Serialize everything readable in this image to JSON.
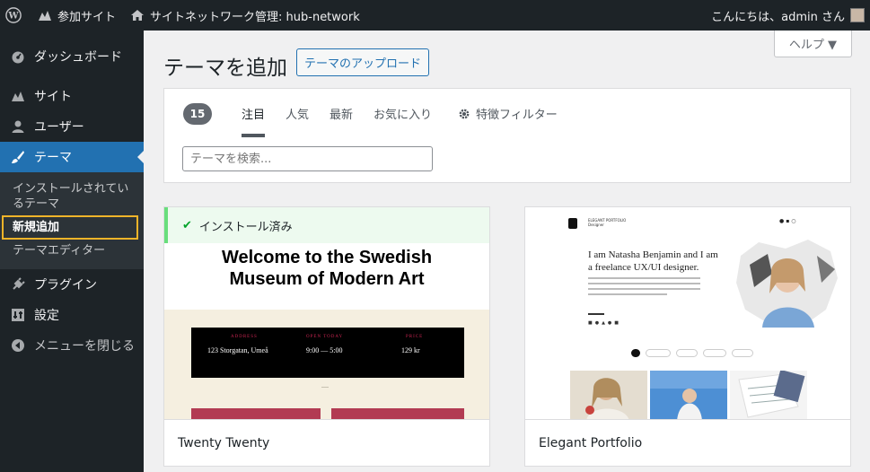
{
  "adminbar": {
    "site_name": "参加サイト",
    "network": "サイトネットワーク管理: hub-network",
    "greeting": "こんにちは、admin さん"
  },
  "sidebar": {
    "items": [
      {
        "label": "ダッシュボード",
        "icon": "gauge-icon"
      },
      {
        "label": "サイト",
        "icon": "sites-icon"
      },
      {
        "label": "ユーザー",
        "icon": "user-icon"
      },
      {
        "label": "テーマ",
        "icon": "brush-icon",
        "current": true
      },
      {
        "label": "プラグイン",
        "icon": "plugin-icon"
      },
      {
        "label": "設定",
        "icon": "settings-icon"
      },
      {
        "label": "メニューを閉じる",
        "icon": "collapse-icon"
      }
    ],
    "submenu": [
      {
        "label": "インストールされているテーマ"
      },
      {
        "label": "新規追加",
        "active": true
      },
      {
        "label": "テーマエディター"
      }
    ]
  },
  "help": {
    "label": "ヘルプ ▼"
  },
  "header": {
    "title": "テーマを追加",
    "upload_label": "テーマのアップロード"
  },
  "filter": {
    "count": "15",
    "tabs": [
      "注目",
      "人気",
      "最新",
      "お気に入り"
    ],
    "feature_filter": "特徴フィルター",
    "search_placeholder": "テーマを検索..."
  },
  "themes": [
    {
      "name": "Twenty Twenty",
      "installed_label": "インストール済み",
      "preview": {
        "heading_line1": "Welcome to the Swedish",
        "heading_line2": "Museum of Modern Art",
        "col1_label": "ADDRESS",
        "col1_value": "123 Storgatan, Umeå",
        "col2_label": "OPEN TODAY",
        "col2_value": "9:00 — 5:00",
        "col3_label": "PRICE",
        "col3_value": "129 kr"
      }
    },
    {
      "name": "Elegant Portfolio",
      "preview": {
        "title": "I am Natasha Benjamin and I am a freelance UX/UI designer.",
        "nav_line1": "ELEGANT PORTFOLIO",
        "nav_line2": "Designer"
      }
    }
  ],
  "colors": {
    "admin_dark": "#1d2327",
    "accent": "#2271b1",
    "installed_green": "#68de7c",
    "highlight": "#f0b429"
  }
}
